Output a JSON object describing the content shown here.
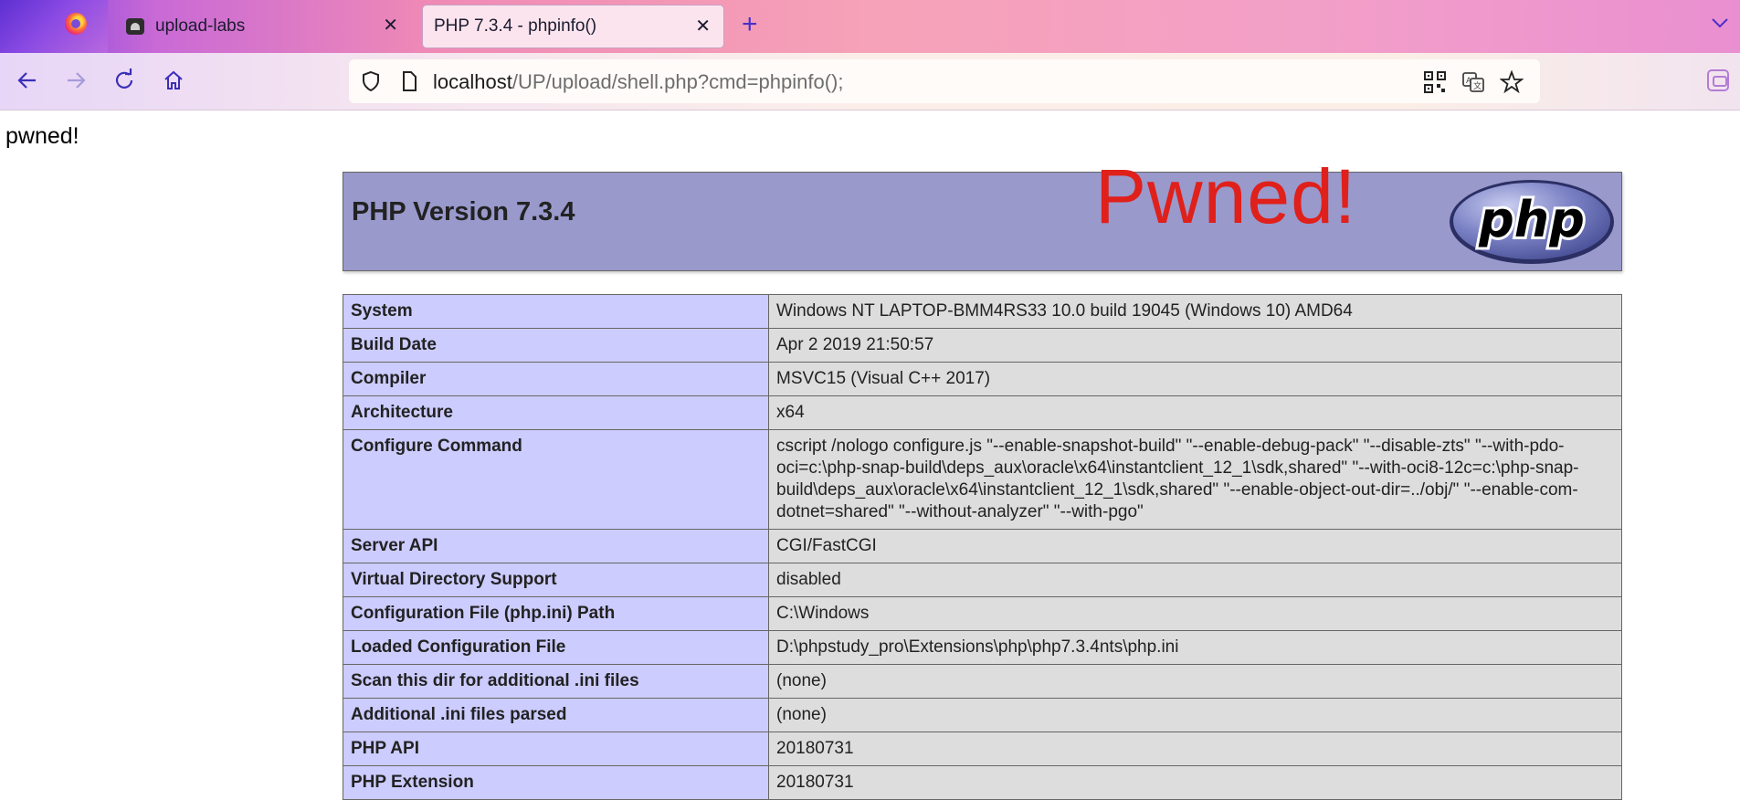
{
  "browser": {
    "tabs": [
      {
        "title": "upload-labs",
        "active": false
      },
      {
        "title": "PHP 7.3.4 - phpinfo()",
        "active": true
      }
    ],
    "newtab_symbol": "+",
    "url": {
      "host": "localhost",
      "path": "/UP/upload/shell.php?cmd=phpinfo();"
    },
    "icons": [
      "firefox-logo-icon",
      "tab-favicon-icon",
      "close-icon",
      "plus-icon",
      "chevron-down-icon",
      "back-arrow-icon",
      "forward-arrow-icon",
      "reload-icon",
      "home-icon",
      "shield-icon",
      "page-icon",
      "qr-code-icon",
      "translate-icon",
      "star-icon",
      "extension-icon"
    ]
  },
  "page": {
    "echo_text": "pwned!",
    "header": {
      "version_title": "PHP Version 7.3.4",
      "overlay_text": "Pwned!",
      "logo_text": "php"
    },
    "rows": [
      {
        "label": "System",
        "value": "Windows NT LAPTOP-BMM4RS33 10.0 build 19045 (Windows 10) AMD64"
      },
      {
        "label": "Build Date",
        "value": "Apr 2 2019 21:50:57"
      },
      {
        "label": "Compiler",
        "value": "MSVC15 (Visual C++ 2017)"
      },
      {
        "label": "Architecture",
        "value": "x64"
      },
      {
        "label": "Configure Command",
        "value": "cscript /nologo configure.js \"--enable-snapshot-build\" \"--enable-debug-pack\" \"--disable-zts\" \"--with-pdo-oci=c:\\php-snap-build\\deps_aux\\oracle\\x64\\instantclient_12_1\\sdk,shared\" \"--with-oci8-12c=c:\\php-snap-build\\deps_aux\\oracle\\x64\\instantclient_12_1\\sdk,shared\" \"--enable-object-out-dir=../obj/\" \"--enable-com-dotnet=shared\" \"--without-analyzer\" \"--with-pgo\""
      },
      {
        "label": "Server API",
        "value": "CGI/FastCGI"
      },
      {
        "label": "Virtual Directory Support",
        "value": "disabled"
      },
      {
        "label": "Configuration File (php.ini) Path",
        "value": "C:\\Windows"
      },
      {
        "label": "Loaded Configuration File",
        "value": "D:\\phpstudy_pro\\Extensions\\php\\php7.3.4nts\\php.ini"
      },
      {
        "label": "Scan this dir for additional .ini files",
        "value": "(none)"
      },
      {
        "label": "Additional .ini files parsed",
        "value": "(none)"
      },
      {
        "label": "PHP API",
        "value": "20180731"
      },
      {
        "label": "PHP Extension",
        "value": "20180731"
      }
    ]
  }
}
